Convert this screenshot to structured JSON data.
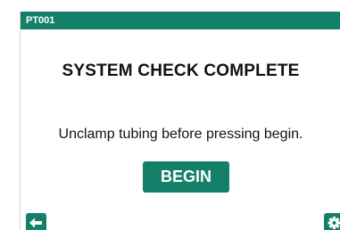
{
  "header": {
    "device_id": "PT001"
  },
  "main": {
    "title": "SYSTEM CHECK COMPLETE",
    "message": "Unclamp tubing before pressing begin.",
    "begin_label": "BEGIN"
  },
  "footer": {
    "back_icon": "arrow-left-icon",
    "settings_icon": "gear-icon"
  },
  "colors": {
    "accent": "#14806a",
    "text": "#111111",
    "background": "#ffffff"
  }
}
